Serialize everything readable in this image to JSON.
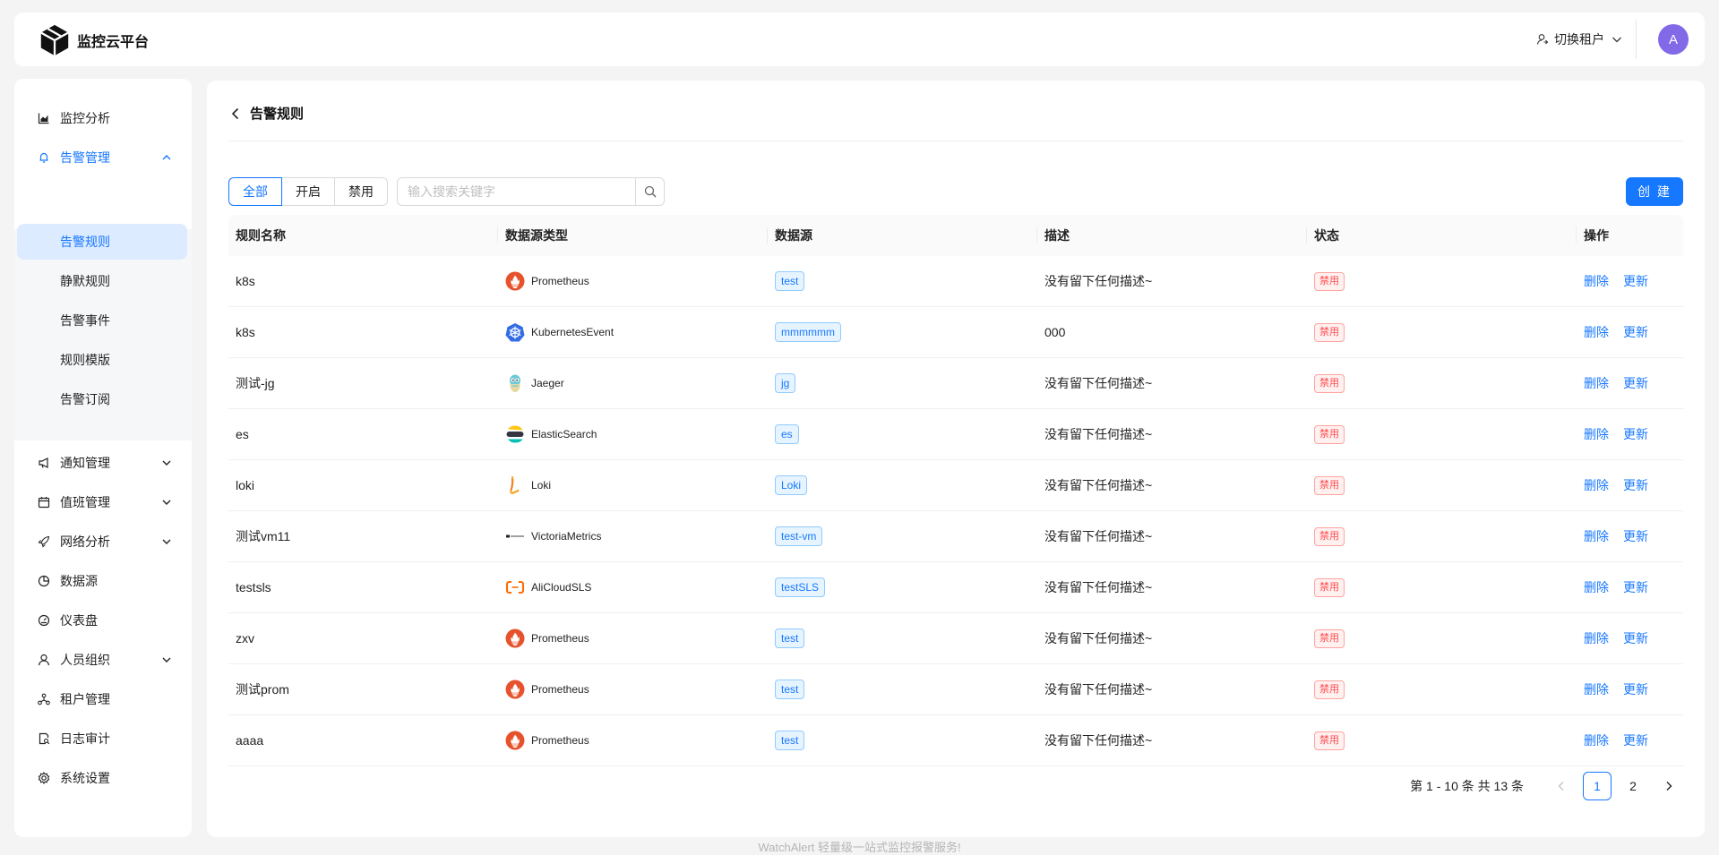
{
  "app": {
    "title": "监控云平台"
  },
  "header": {
    "tenant_switch": "切换租户",
    "avatar": "A"
  },
  "sidebar": {
    "items": [
      {
        "label": "监控分析",
        "icon": "area-chart-icon"
      },
      {
        "label": "告警管理",
        "icon": "bell-icon",
        "expanded": true
      },
      {
        "label": "通知管理",
        "icon": "notification-icon"
      },
      {
        "label": "值班管理",
        "icon": "calendar-icon"
      },
      {
        "label": "网络分析",
        "icon": "rocket-icon"
      },
      {
        "label": "数据源",
        "icon": "pie-chart-icon"
      },
      {
        "label": "仪表盘",
        "icon": "dashboard-icon"
      },
      {
        "label": "人员组织",
        "icon": "user-icon"
      },
      {
        "label": "租户管理",
        "icon": "cluster-icon"
      },
      {
        "label": "日志审计",
        "icon": "file-search-icon"
      },
      {
        "label": "系统设置",
        "icon": "setting-icon"
      }
    ],
    "submenu": [
      {
        "label": "告警规则",
        "active": true
      },
      {
        "label": "静默规则"
      },
      {
        "label": "告警事件"
      },
      {
        "label": "规则模版"
      },
      {
        "label": "告警订阅"
      }
    ]
  },
  "page": {
    "title": "告警规则",
    "filters": [
      "全部",
      "开启",
      "禁用"
    ],
    "search": {
      "placeholder": "输入搜索关键字",
      "value": ""
    },
    "create_label": "创 建"
  },
  "table": {
    "columns": [
      "规则名称",
      "数据源类型",
      "数据源",
      "描述",
      "状态",
      "操作"
    ],
    "rows": [
      {
        "name": "k8s",
        "type": "Prometheus",
        "logo": "prometheus-logo-icon",
        "source": "test",
        "desc": "没有留下任何描述~",
        "status": "禁用"
      },
      {
        "name": "k8s",
        "type": "KubernetesEvent",
        "logo": "kubernetes-logo-icon",
        "source": "mmmmmm",
        "desc": "000",
        "status": "禁用"
      },
      {
        "name": "测试-jg",
        "type": "Jaeger",
        "logo": "jaeger-logo-icon",
        "source": "jg",
        "desc": "没有留下任何描述~",
        "status": "禁用"
      },
      {
        "name": "es",
        "type": "ElasticSearch",
        "logo": "elasticsearch-logo-icon",
        "source": "es",
        "desc": "没有留下任何描述~",
        "status": "禁用"
      },
      {
        "name": "loki",
        "type": "Loki",
        "logo": "loki-logo-icon",
        "source": "Loki",
        "desc": "没有留下任何描述~",
        "status": "禁用"
      },
      {
        "name": "测试vm11",
        "type": "VictoriaMetrics",
        "logo": "victoriametrics-logo-icon",
        "source": "test-vm",
        "desc": "没有留下任何描述~",
        "status": "禁用"
      },
      {
        "name": "testsls",
        "type": "AliCloudSLS",
        "logo": "alicloud-logo-icon",
        "source": "testSLS",
        "desc": "没有留下任何描述~",
        "status": "禁用"
      },
      {
        "name": "zxv",
        "type": "Prometheus",
        "logo": "prometheus-logo-icon",
        "source": "test",
        "desc": "没有留下任何描述~",
        "status": "禁用"
      },
      {
        "name": "测试prom",
        "type": "Prometheus",
        "logo": "prometheus-logo-icon",
        "source": "test",
        "desc": "没有留下任何描述~",
        "status": "禁用"
      },
      {
        "name": "aaaa",
        "type": "Prometheus",
        "logo": "prometheus-logo-icon",
        "source": "test",
        "desc": "没有留下任何描述~",
        "status": "禁用"
      }
    ],
    "actions": {
      "delete": "删除",
      "update": "更新"
    }
  },
  "pagination": {
    "total_text": "第 1 - 10 条 共 13 条",
    "pages": [
      "1",
      "2"
    ],
    "current": "1"
  },
  "footer": {
    "text": "WatchAlert 轻量级一站式监控报警服务!"
  },
  "colors": {
    "primary": "#1677ff",
    "danger": "#ff4d4f",
    "avatar": "#8169e8",
    "background": "#f4f4f4"
  }
}
